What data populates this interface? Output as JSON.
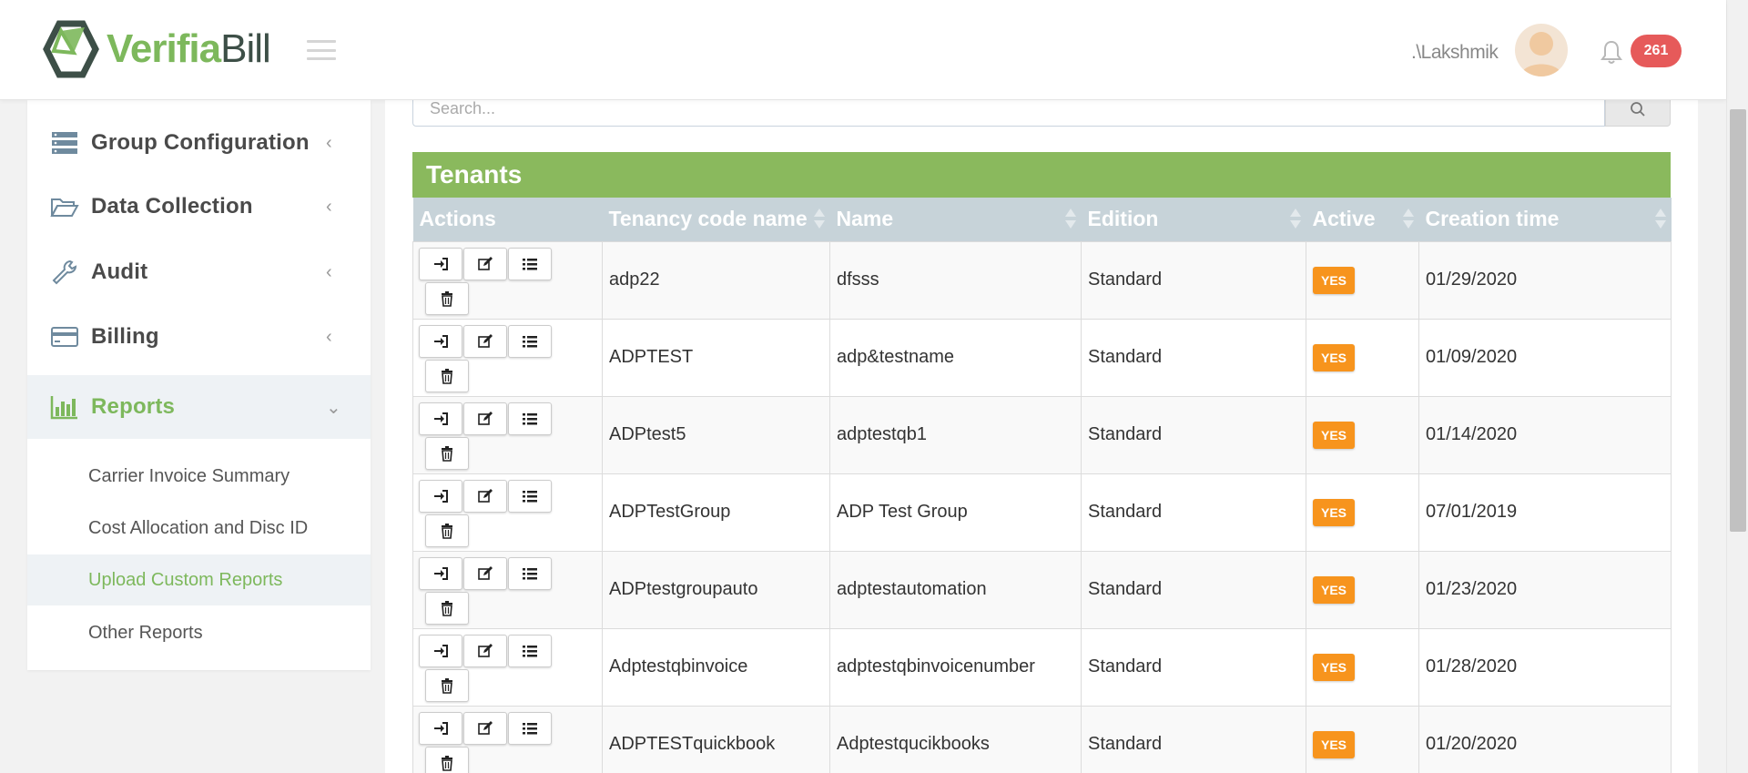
{
  "header": {
    "logo_bold": "Verifia",
    "logo_light": "Bill",
    "username": ".\\Lakshmik",
    "notification_count": "261"
  },
  "sidebar": {
    "items": [
      {
        "label": "Group Configuration",
        "icon": "server-icon",
        "chevron": "‹"
      },
      {
        "label": "Data Collection",
        "icon": "folder-open-icon",
        "chevron": "‹"
      },
      {
        "label": "Audit",
        "icon": "wrench-icon",
        "chevron": "‹"
      },
      {
        "label": "Billing",
        "icon": "credit-card-icon",
        "chevron": "‹"
      },
      {
        "label": "Reports",
        "icon": "bar-chart-icon",
        "chevron": "⌄",
        "active": true
      }
    ],
    "subitems": [
      {
        "label": "Carrier Invoice Summary"
      },
      {
        "label": "Cost Allocation and Disc ID"
      },
      {
        "label": "Upload Custom Reports",
        "active": true
      },
      {
        "label": "Other Reports"
      }
    ]
  },
  "search": {
    "placeholder": "Search..."
  },
  "table": {
    "title": "Tenants",
    "columns": [
      "Actions",
      "Tenancy code name",
      "Name",
      "Edition",
      "Active",
      "Creation time"
    ],
    "rows": [
      {
        "code": "adp22",
        "name": "dfsss",
        "edition": "Standard",
        "active": "YES",
        "created": "01/29/2020"
      },
      {
        "code": "ADPTEST",
        "name": "adp&testname",
        "edition": "Standard",
        "active": "YES",
        "created": "01/09/2020"
      },
      {
        "code": "ADPtest5",
        "name": "adptestqb1",
        "edition": "Standard",
        "active": "YES",
        "created": "01/14/2020"
      },
      {
        "code": "ADPTestGroup",
        "name": "ADP Test Group",
        "edition": "Standard",
        "active": "YES",
        "created": "07/01/2019"
      },
      {
        "code": "ADPtestgroupauto",
        "name": "adptestautomation",
        "edition": "Standard",
        "active": "YES",
        "created": "01/23/2020"
      },
      {
        "code": "Adptestqbinvoice",
        "name": "adptestqbinvoicenumber",
        "edition": "Standard",
        "active": "YES",
        "created": "01/28/2020"
      },
      {
        "code": "ADPTESTquickbook",
        "name": "Adptestqucikbooks",
        "edition": "Standard",
        "active": "YES",
        "created": "01/20/2020"
      }
    ]
  },
  "colors": {
    "brand_green": "#8ab95d",
    "active_badge": "#f7941d",
    "notification": "#e65a5a",
    "header_row": "#c7d3d9"
  }
}
